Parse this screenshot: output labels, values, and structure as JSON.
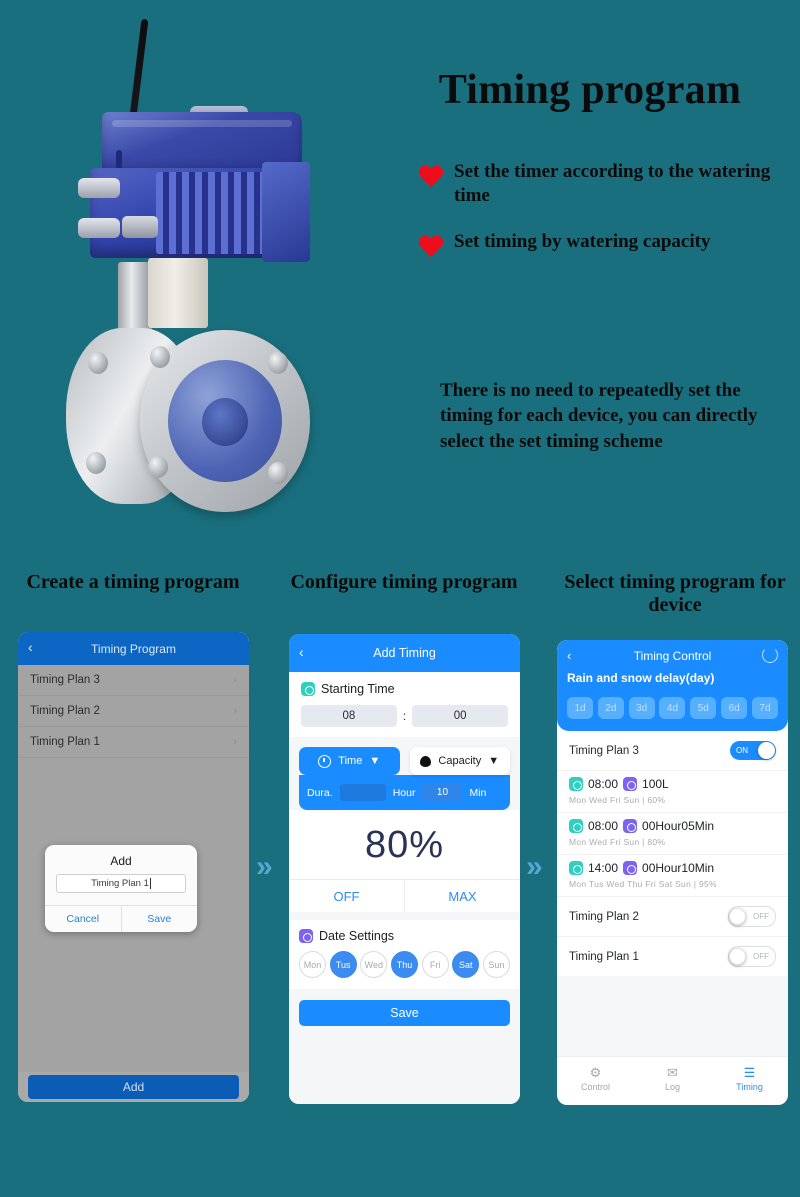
{
  "background_color": "#1a6f7e",
  "hero": {
    "title": "Timing program",
    "bullets": [
      "Set the timer according to the watering time",
      "Set timing by watering capacity"
    ],
    "paragraph": "There is no need to repeatedly set the timing for each device, you can directly select the set timing scheme",
    "product_alt": "wifi electric actuator flanged ball valve",
    "bullet_icon": "heart-icon",
    "accent_color": "#ee0d1c"
  },
  "columns": [
    {
      "heading": "Create a timing program"
    },
    {
      "heading": "Configure timing program"
    },
    {
      "heading": "Select timing program for device"
    }
  ],
  "arrow": "»",
  "screen1": {
    "nav": {
      "back_icon": "chevron-left-icon",
      "title": "Timing Program"
    },
    "plans": [
      {
        "label": "Timing Plan 3",
        "chevron": "›"
      },
      {
        "label": "Timing Plan 2",
        "chevron": "›"
      },
      {
        "label": "Timing Plan 1",
        "chevron": "›"
      }
    ],
    "dialog": {
      "title": "Add",
      "input_value": "Timing Plan 1",
      "cancel_label": "Cancel",
      "save_label": "Save"
    },
    "add_button": "Add"
  },
  "screen2": {
    "nav": {
      "back_icon": "chevron-left-icon",
      "title": "Add Timing"
    },
    "starting_time": {
      "label": "Starting Time",
      "icon": "timer-icon",
      "hour": "08",
      "separator": ":",
      "minute": "00"
    },
    "modes": [
      {
        "label": "Time",
        "icon": "clock-icon",
        "caret": "▼",
        "active": true
      },
      {
        "label": "Capacity",
        "icon": "drop-icon",
        "caret": "▼",
        "active": false
      }
    ],
    "duration": {
      "label": "Dura.",
      "hour_value": "",
      "hour_unit": "Hour",
      "minute_value": "10",
      "minute_unit": "Min"
    },
    "percent": "80%",
    "range": {
      "min_label": "OFF",
      "max_label": "MAX"
    },
    "date_settings": {
      "label": "Date Settings",
      "icon": "calendar-icon",
      "days": [
        {
          "label": "Mon",
          "selected": false
        },
        {
          "label": "Tus",
          "selected": true
        },
        {
          "label": "Wed",
          "selected": false
        },
        {
          "label": "Thu",
          "selected": true
        },
        {
          "label": "Fri",
          "selected": false
        },
        {
          "label": "Sat",
          "selected": true
        },
        {
          "label": "Sun",
          "selected": false
        }
      ]
    },
    "save_button": "Save"
  },
  "screen3": {
    "nav": {
      "back_icon": "chevron-left-icon",
      "title": "Timing Control",
      "refresh_icon": "refresh-icon"
    },
    "delay_label": "Rain and snow delay(day)",
    "delay_chips": [
      "1d",
      "2d",
      "3d",
      "4d",
      "5d",
      "6d",
      "7d"
    ],
    "active_plan": {
      "label": "Timing Plan 3",
      "toggle_label": "ON",
      "toggle_on": true,
      "entries": [
        {
          "time": "08:00",
          "time_icon": "timer-icon",
          "value": "100L",
          "value_icon": "capacity-icon",
          "days": "Mon  Wed  Fri  Sun",
          "separator": "|",
          "percent": "60%"
        },
        {
          "time": "08:00",
          "time_icon": "timer-icon",
          "value": "00Hour05Min",
          "value_icon": "duration-icon",
          "days": "Mon  Wed  Fri  Sun",
          "separator": "|",
          "percent": "80%"
        },
        {
          "time": "14:00",
          "time_icon": "timer-icon",
          "value": "00Hour10Min",
          "value_icon": "duration-icon",
          "days": "Mon  Tus  Wed  Thu  Fri  Sat  Sun",
          "separator": "|",
          "percent": "95%"
        }
      ]
    },
    "other_plans": [
      {
        "label": "Timing Plan 2",
        "toggle_label": "OFF",
        "toggle_on": false
      },
      {
        "label": "Timing Plan 1",
        "toggle_label": "OFF",
        "toggle_on": false
      }
    ],
    "tabs": [
      {
        "label": "Control",
        "icon": "gear-icon",
        "glyph": "⚙",
        "active": false
      },
      {
        "label": "Log",
        "icon": "mail-icon",
        "glyph": "✉",
        "active": false
      },
      {
        "label": "Timing",
        "icon": "list-icon",
        "glyph": "☰",
        "active": true
      }
    ]
  }
}
